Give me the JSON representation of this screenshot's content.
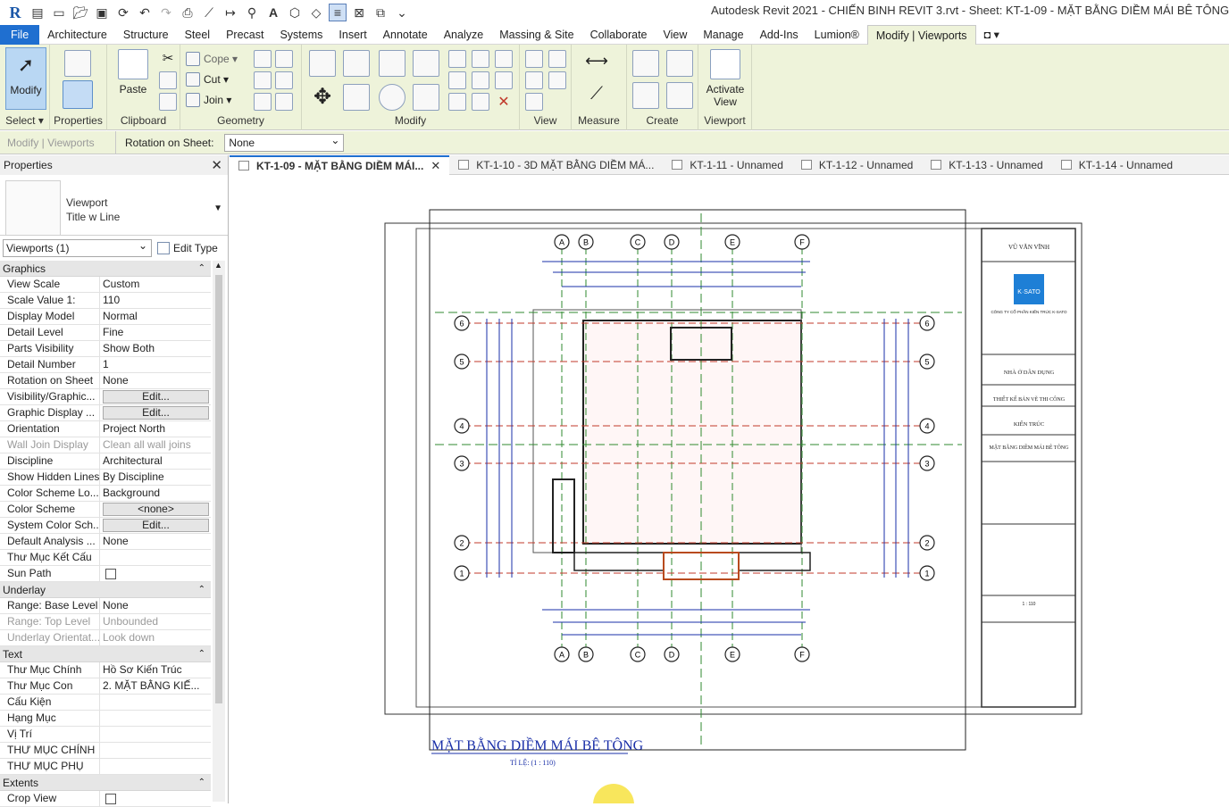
{
  "app": {
    "logo": "R",
    "title": "Autodesk Revit 2021 - CHIẾN BINH REVIT 3.rvt - Sheet: KT-1-09 - MẶT BẰNG DIỀM MÁI BÊ TÔNG"
  },
  "menu": [
    "File",
    "Architecture",
    "Structure",
    "Steel",
    "Precast",
    "Systems",
    "Insert",
    "Annotate",
    "Analyze",
    "Massing & Site",
    "Collaborate",
    "View",
    "Manage",
    "Add-Ins",
    "Lumion®",
    "Modify | Viewports"
  ],
  "ribbon": {
    "modify": "Modify",
    "select": "Select ▾",
    "properties": "Properties",
    "paste": "Paste",
    "clipboard": "Clipboard",
    "cope": "Cope",
    "cut": "Cut",
    "join": "Join",
    "geometry": "Geometry",
    "modify_panel": "Modify",
    "view_panel": "View",
    "measure_panel": "Measure",
    "create_panel": "Create",
    "activate_view_1": "Activate",
    "activate_view_2": "View",
    "viewport_panel": "Viewport"
  },
  "options": {
    "context": "Modify | Viewports",
    "rotation_label": "Rotation on Sheet:",
    "rotation_value": "None"
  },
  "properties": {
    "header": "Properties",
    "type_line1": "Viewport",
    "type_line2": "Title w Line",
    "filter": "Viewports (1)",
    "edit_type": "Edit Type",
    "sections": {
      "graphics": "Graphics",
      "underlay": "Underlay",
      "text": "Text",
      "extents": "Extents"
    },
    "graphics": [
      {
        "k": "View Scale",
        "v": "Custom"
      },
      {
        "k": "Scale Value    1:",
        "v": "110"
      },
      {
        "k": "Display Model",
        "v": "Normal"
      },
      {
        "k": "Detail Level",
        "v": "Fine"
      },
      {
        "k": "Parts Visibility",
        "v": "Show Both"
      },
      {
        "k": "Detail Number",
        "v": "1"
      },
      {
        "k": "Rotation on Sheet",
        "v": "None"
      },
      {
        "k": "Visibility/Graphic...",
        "v": "Edit..."
      },
      {
        "k": "Graphic Display ...",
        "v": "Edit..."
      },
      {
        "k": "Orientation",
        "v": "Project North"
      },
      {
        "k": "Wall Join Display",
        "v": "Clean all wall joins"
      },
      {
        "k": "Discipline",
        "v": "Architectural"
      },
      {
        "k": "Show Hidden Lines",
        "v": "By Discipline"
      },
      {
        "k": "Color Scheme Lo...",
        "v": "Background"
      },
      {
        "k": "Color Scheme",
        "v": "<none>"
      },
      {
        "k": "System Color Sch...",
        "v": "Edit..."
      },
      {
        "k": "Default Analysis ...",
        "v": "None"
      },
      {
        "k": "Thư Mục Kết Cấu",
        "v": ""
      },
      {
        "k": "Sun Path",
        "v": ""
      }
    ],
    "underlay": [
      {
        "k": "Range: Base Level",
        "v": "None"
      },
      {
        "k": "Range: Top Level",
        "v": "Unbounded"
      },
      {
        "k": "Underlay Orientat...",
        "v": "Look down"
      }
    ],
    "text": [
      {
        "k": "Thư Mục Chính",
        "v": "Hồ Sơ Kiến Trúc"
      },
      {
        "k": "Thư Mục Con",
        "v": "2. MẶT BẰNG KIẾ..."
      },
      {
        "k": "Cấu Kiện",
        "v": ""
      },
      {
        "k": "Hạng Mục",
        "v": ""
      },
      {
        "k": "Vị Trí",
        "v": ""
      },
      {
        "k": "THƯ MỤC CHÍNH",
        "v": ""
      },
      {
        "k": "THƯ MỤC PHỤ",
        "v": ""
      }
    ],
    "extents": [
      {
        "k": "Crop View",
        "v": ""
      }
    ]
  },
  "view_tabs": [
    "KT-1-09 - MẶT BẰNG DIỀM MÁI...",
    "KT-1-10 - 3D MẶT BẰNG DIỀM MÁ...",
    "KT-1-11 - Unnamed",
    "KT-1-12 - Unnamed",
    "KT-1-13 - Unnamed",
    "KT-1-14 - Unnamed"
  ],
  "sheet": {
    "view_title": "MẶT BẰNG DIỀM MÁI BÊ TÔNG",
    "view_scale": "TỈ LỆ: (1 : 110)",
    "grid_top": [
      "A",
      "B",
      "C",
      "D",
      "E",
      "F"
    ],
    "grid_side": [
      "6",
      "5",
      "4",
      "3",
      "2",
      "1"
    ],
    "titleblock": {
      "owner": "VŨ VĂN VĨNH",
      "company": "CÔNG TY CỔ PHẦN KIẾN TRÚC K-SATO",
      "project": "NHÀ Ở DÂN DỤNG",
      "stage": "THIẾT KẾ BẢN VẼ THI CÔNG",
      "category": "KIẾN TRÚC",
      "sheet_name": "MẶT BẰNG DIỀM MÁI BÊ TÔNG",
      "scale": "1 : 110",
      "logo": "K·SATO"
    }
  }
}
